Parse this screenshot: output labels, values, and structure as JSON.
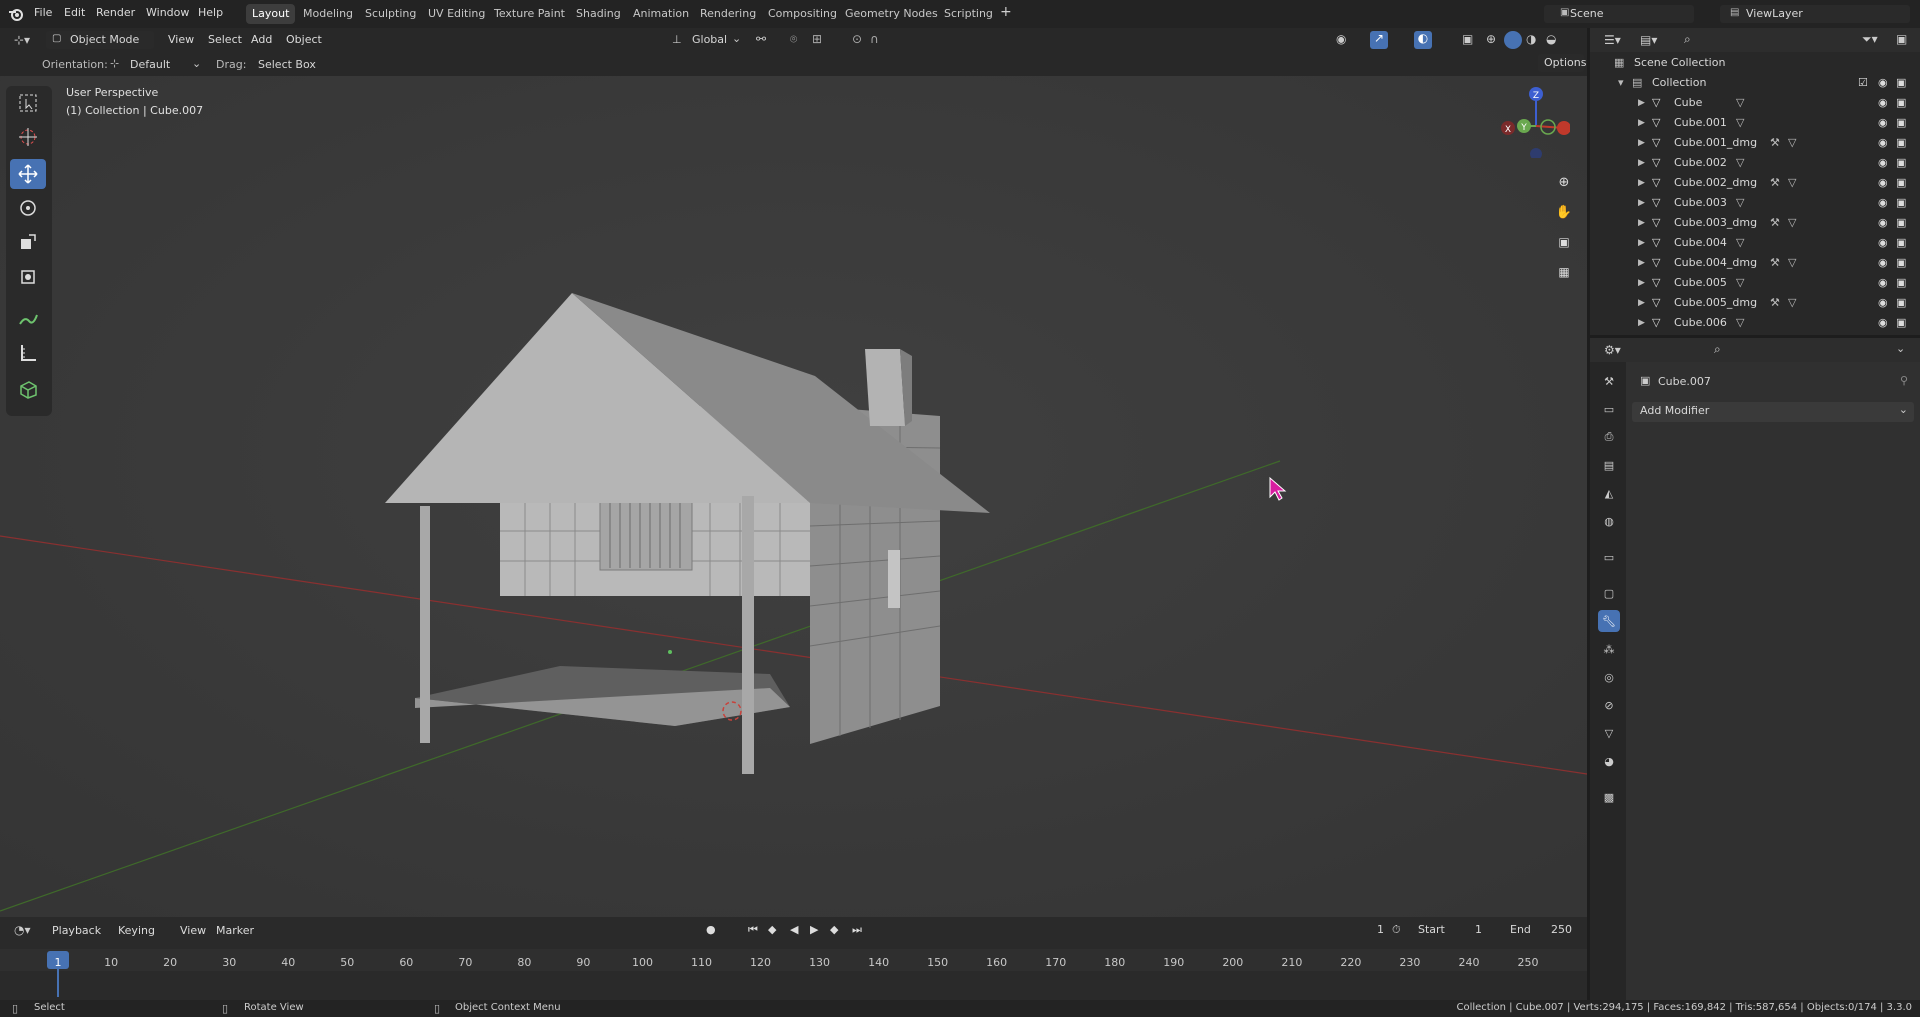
{
  "topbar": {
    "menus": [
      "File",
      "Edit",
      "Render",
      "Window",
      "Help"
    ],
    "workspaces": [
      "Layout",
      "Modeling",
      "Sculpting",
      "UV Editing",
      "Texture Paint",
      "Shading",
      "Animation",
      "Rendering",
      "Compositing",
      "Geometry Nodes",
      "Scripting"
    ],
    "active_workspace": "Layout",
    "scene": "Scene",
    "view_layer": "ViewLayer"
  },
  "vp_header": {
    "mode": "Object Mode",
    "menus": [
      "View",
      "Select",
      "Add",
      "Object"
    ],
    "transform_space": "Global",
    "orientation_label": "Orientation:",
    "orientation_value": "Default",
    "drag_label": "Drag:",
    "drag_value": "Select Box",
    "options": "Options"
  },
  "viewport": {
    "perspective": "User Perspective",
    "collection_info": "(1) Collection | Cube.007",
    "gizmo_axes": [
      "Z",
      "Y",
      "X"
    ]
  },
  "outliner": {
    "root": "Scene Collection",
    "collection": "Collection",
    "items": [
      {
        "name": "Cube",
        "modifier": false
      },
      {
        "name": "Cube.001",
        "modifier": false
      },
      {
        "name": "Cube.001_dmg",
        "modifier": true
      },
      {
        "name": "Cube.002",
        "modifier": false
      },
      {
        "name": "Cube.002_dmg",
        "modifier": true
      },
      {
        "name": "Cube.003",
        "modifier": false
      },
      {
        "name": "Cube.003_dmg",
        "modifier": true
      },
      {
        "name": "Cube.004",
        "modifier": false
      },
      {
        "name": "Cube.004_dmg",
        "modifier": true
      },
      {
        "name": "Cube.005",
        "modifier": false
      },
      {
        "name": "Cube.005_dmg",
        "modifier": true
      },
      {
        "name": "Cube.006",
        "modifier": false
      }
    ]
  },
  "properties": {
    "object_name": "Cube.007",
    "add_modifier": "Add Modifier"
  },
  "timeline": {
    "menus": [
      "Playback",
      "Keying",
      "View",
      "Marker"
    ],
    "current_frame": "1",
    "start_label": "Start",
    "start_value": "1",
    "end_label": "End",
    "end_value": "250",
    "ticks": [
      "1",
      "10",
      "20",
      "30",
      "40",
      "50",
      "60",
      "70",
      "80",
      "90",
      "100",
      "110",
      "120",
      "130",
      "140",
      "150",
      "160",
      "170",
      "180",
      "190",
      "200",
      "210",
      "220",
      "230",
      "240",
      "250"
    ]
  },
  "statusbar": {
    "select": "Select",
    "rotate": "Rotate View",
    "context": "Object Context Menu",
    "stats": "Collection | Cube.007 | Verts:294,175 | Faces:169,842 | Tris:587,654 | Objects:0/174 | 3.3.0"
  },
  "colors": {
    "accent": "#4772b3",
    "x_axis": "#c0392b",
    "y_axis": "#6aa84f",
    "z_axis": "#3d5fd1",
    "cursor": "#d81ca0"
  }
}
